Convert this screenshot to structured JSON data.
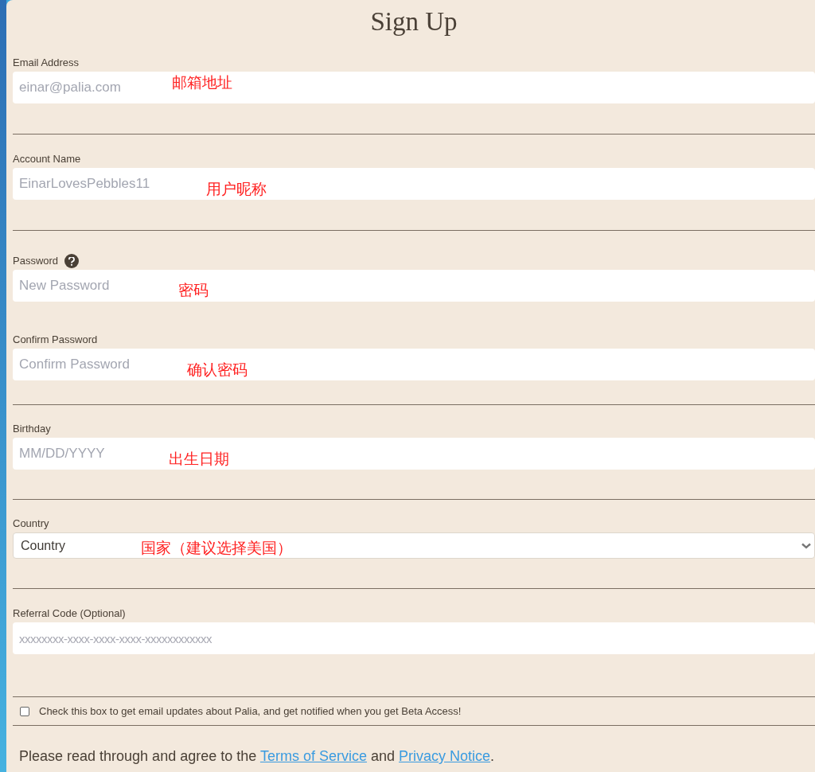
{
  "title": "Sign Up",
  "sections": [
    {
      "fields": [
        {
          "kind": "text",
          "label": "Email Address",
          "placeholder": "einar@palia.com",
          "help": false,
          "annotation": "邮箱地址"
        }
      ]
    },
    {
      "fields": [
        {
          "kind": "text",
          "label": "Account Name",
          "placeholder": "EinarLovesPebbles11",
          "help": false,
          "annotation": "用户昵称"
        }
      ]
    },
    {
      "fields": [
        {
          "kind": "text",
          "label": "Password",
          "placeholder": "New Password",
          "help": true,
          "annotation": "密码"
        },
        {
          "kind": "text",
          "label": "Confirm Password",
          "placeholder": "Confirm Password",
          "help": false,
          "annotation": "确认密码"
        }
      ]
    },
    {
      "fields": [
        {
          "kind": "text",
          "label": "Birthday",
          "placeholder": "MM/DD/YYYY",
          "help": false,
          "annotation": "出生日期"
        }
      ]
    },
    {
      "fields": [
        {
          "kind": "select",
          "label": "Country",
          "value": "Country",
          "help": false,
          "annotation": "国家（建议选择美国）"
        }
      ]
    },
    {
      "fields": [
        {
          "kind": "code",
          "label": "Referral Code (Optional)",
          "placeholder": "xxxxxxxx-xxxx-xxxx-xxxx-xxxxxxxxxxxx",
          "help": false
        }
      ]
    }
  ],
  "newsletter": {
    "checked": false,
    "label": "Check this box to get email updates about Palia, and get notified when you get Beta Access!"
  },
  "agreement": {
    "before": "Please read through and agree to the",
    "terms": "Terms of Service",
    "middle": "and",
    "privacy": "Privacy Notice",
    "after": "."
  }
}
